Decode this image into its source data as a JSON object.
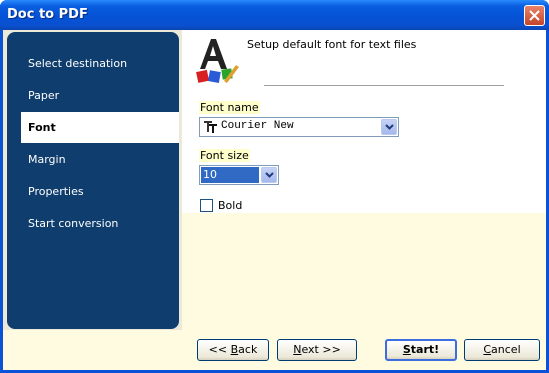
{
  "window": {
    "title": "Doc to PDF"
  },
  "sidebar": {
    "items": [
      {
        "label": "Select destination"
      },
      {
        "label": "Paper"
      },
      {
        "label": "Font",
        "active": true
      },
      {
        "label": "Margin"
      },
      {
        "label": "Properties"
      },
      {
        "label": "Start conversion"
      }
    ]
  },
  "header": {
    "text": "Setup default font for text files",
    "icon": "font-icon"
  },
  "form": {
    "font_name_label": "Font name",
    "font_name_value": "Courier New",
    "font_size_label": "Font size",
    "font_size_value": "10",
    "bold_label": "Bold",
    "bold_checked": false
  },
  "buttons": {
    "back_prefix": "<< ",
    "back_access": "B",
    "back_rest": "ack",
    "next_access": "N",
    "next_rest": "ext >>",
    "start_access": "S",
    "start_rest": "tart!",
    "cancel_access": "C",
    "cancel_rest": "ancel"
  },
  "colors": {
    "sidebar_bg": "#0f3d6e",
    "content_bg": "#fffbe0",
    "selection": "#316ac5"
  }
}
